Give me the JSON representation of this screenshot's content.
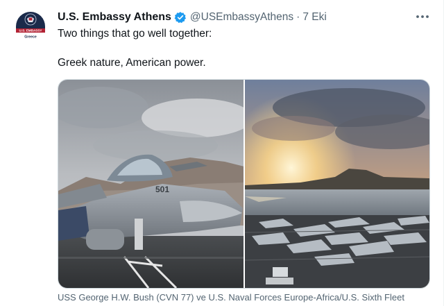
{
  "author": {
    "display_name": "U.S. Embassy Athens",
    "handle": "@USEmbassyAthens",
    "separator": "·",
    "timestamp": "7 Eki",
    "verified": true,
    "avatar": {
      "badge_text": "U.S. EMBASSY",
      "location_text": "Greece"
    }
  },
  "tweet": {
    "lines": [
      "Two things that go well together:",
      "Greek nature, American power."
    ]
  },
  "media": {
    "photos": [
      {
        "subject": "fighter-jet-on-carrier-deck",
        "marking": "501"
      },
      {
        "subject": "sunset-over-carrier-flight-deck"
      }
    ],
    "caption": "USS George H.W. Bush (CVN 77) ve U.S. Naval Forces Europe-Africa/U.S. Sixth Fleet"
  },
  "icons": {
    "more": "more-options-icon",
    "verified": "verified-badge-icon"
  },
  "colors": {
    "verified_blue": "#1d9bf0",
    "text_primary": "#0f1419",
    "text_secondary": "#536471",
    "avatar_navy": "#1b2a4a",
    "avatar_red": "#b22234"
  }
}
